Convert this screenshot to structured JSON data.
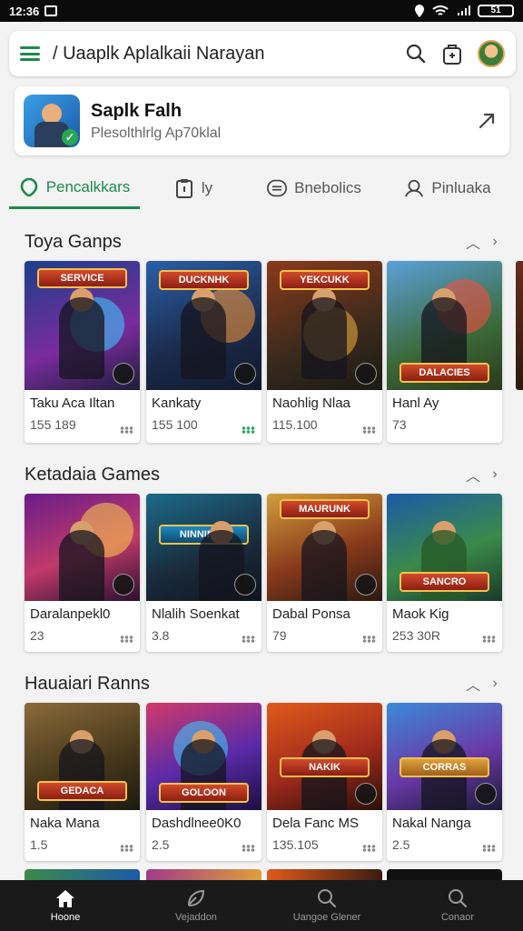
{
  "status_bar": {
    "time": "12:36",
    "battery": "51"
  },
  "search_bar": {
    "title": "/ Uaaplk Aplalkaii Narayan",
    "icons": [
      "menu-icon",
      "search-icon",
      "cart-icon",
      "avatar"
    ]
  },
  "app_card": {
    "name": "Saplk Falh",
    "subtitle": "Plesolthlrlg Ap70klal"
  },
  "tabs": [
    {
      "label": "Pencalkkars",
      "icon": "map-pin-icon",
      "active": true
    },
    {
      "label": "ly",
      "icon": "clipboard-icon",
      "active": false
    },
    {
      "label": "Bnebolics",
      "icon": "chat-icon",
      "active": false
    },
    {
      "label": "Pinluaka",
      "icon": "person-icon",
      "active": false
    }
  ],
  "sections": [
    {
      "title": "Toya Ganps",
      "games": [
        {
          "name": "Taku Aca Iltan",
          "stat": "155 189",
          "banner": "SERVICE"
        },
        {
          "name": "Kankaty",
          "stat": "155 100",
          "banner": "DUCKNHK"
        },
        {
          "name": "Naohlig Nlaa",
          "stat": "115.100",
          "banner": "YEKCUKK"
        },
        {
          "name": "Hanl Ay",
          "stat": "73",
          "banner": "DALACIES"
        }
      ]
    },
    {
      "title": "Ketadaia Games",
      "games": [
        {
          "name": "Daralanpekl0",
          "stat": "23",
          "banner": ""
        },
        {
          "name": "Nlalih Soenkat",
          "stat": "3.8",
          "banner": "NINNINAS"
        },
        {
          "name": "Dabal Ponsa",
          "stat": "79",
          "banner": "MAURUNK"
        },
        {
          "name": "Maok Kig",
          "stat": "253 30R",
          "banner": "SANCRO"
        }
      ]
    },
    {
      "title": "Hauaiari Ranns",
      "games": [
        {
          "name": "Naka Mana",
          "stat": "1.5",
          "banner": "GEDACA"
        },
        {
          "name": "Dashdlnee0K0",
          "stat": "2.5",
          "banner": "GOLOON"
        },
        {
          "name": "Dela Fanc MS",
          "stat": "135.105",
          "banner": "NAKIK"
        },
        {
          "name": "Nakal Nanga",
          "stat": "2.5",
          "banner": "CORRAS"
        }
      ]
    }
  ],
  "bottom_nav": [
    {
      "label": "Hoone",
      "icon": "home-icon",
      "active": true
    },
    {
      "label": "Vejaddon",
      "icon": "leaf-icon",
      "active": false
    },
    {
      "label": "Uangoe Glener",
      "icon": "search-icon",
      "active": false
    },
    {
      "label": "Conaor",
      "icon": "search-icon",
      "active": false
    }
  ],
  "colors": {
    "accent": "#1e8a4a",
    "background": "#f3f3f3",
    "nav_background": "#1a1a1a"
  }
}
